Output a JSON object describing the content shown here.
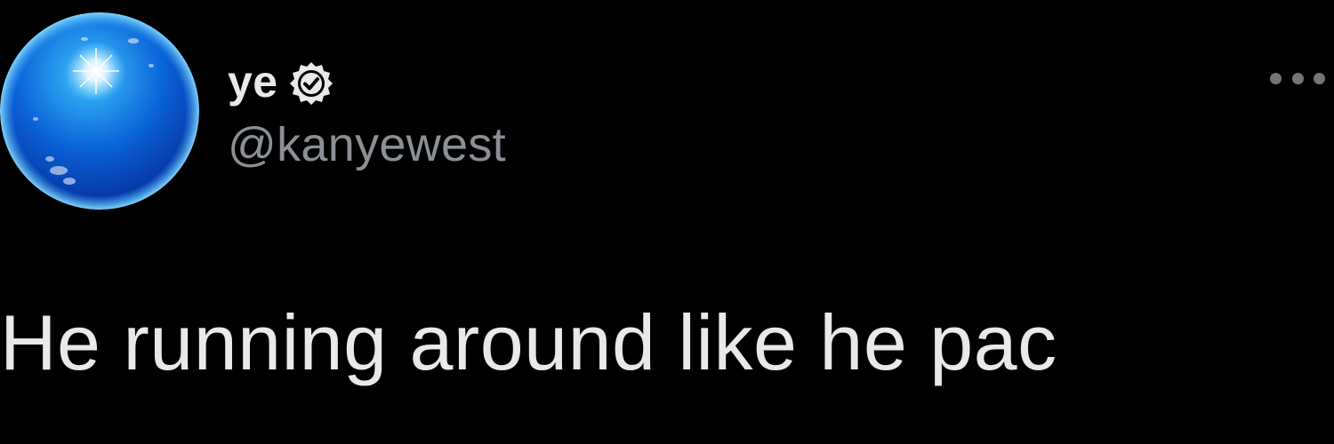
{
  "author": {
    "display_name": "ye",
    "handle": "@kanyewest",
    "verified": true,
    "avatar_icon": "blue-globe-avatar"
  },
  "menu": {
    "icon": "more-options-icon"
  },
  "tweet": {
    "text": "He running around like he pac"
  },
  "colors": {
    "background": "#000000",
    "name": "#e7e9ea",
    "handle": "#8b9096",
    "text": "#e7e9ea",
    "dots": "#71767b",
    "verified_badge": "#e7e9ea"
  }
}
